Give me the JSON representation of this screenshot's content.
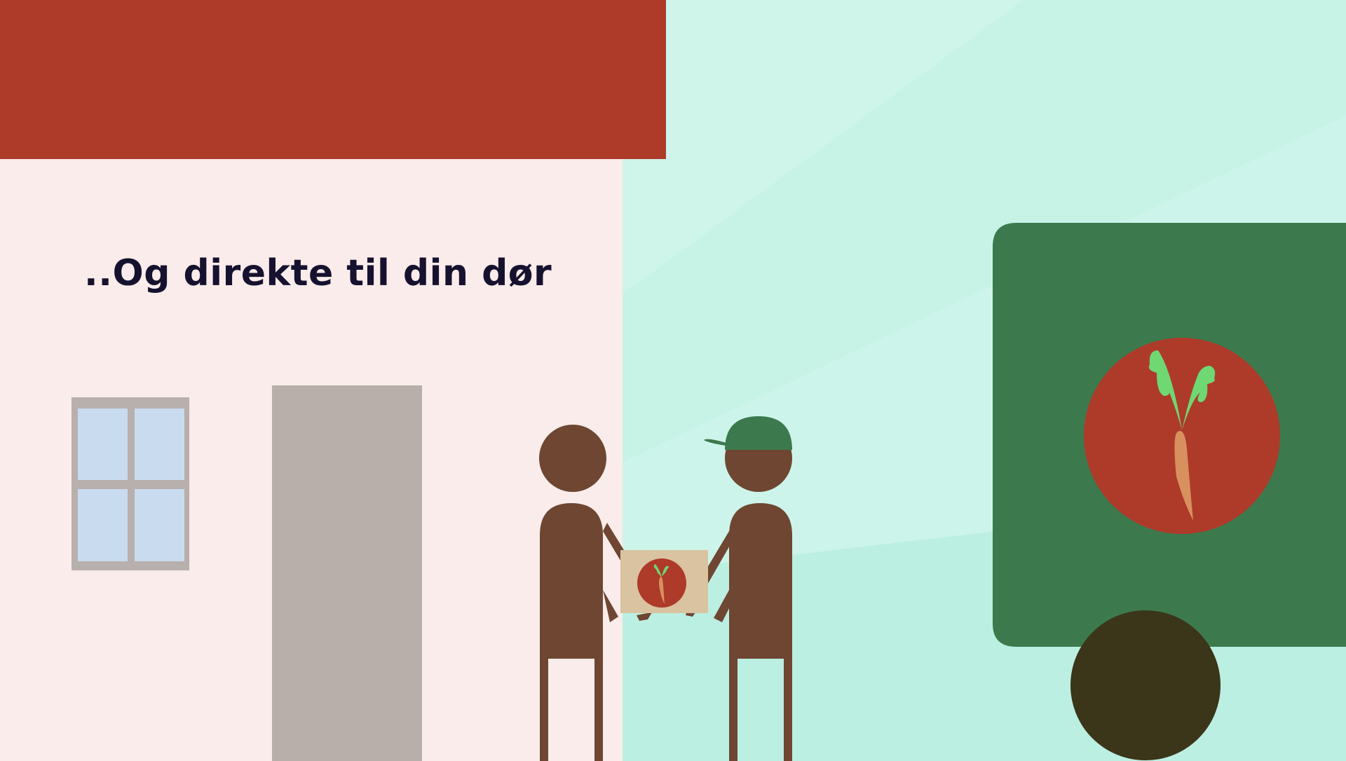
{
  "headline": "..Og direkte til din dør",
  "colors": {
    "roof": "#ae3a2a",
    "house_wall": "#f9ecea",
    "sky_light": "#cff5eb",
    "sky_mid": "#c4f2e6",
    "sky_low": "#bbefe2",
    "window_frame": "#b8b0ad",
    "window_glass": "#c9dbef",
    "door": "#b8afab",
    "person_skin": "#6e4632",
    "cap": "#3c7a4d",
    "parcel": "#d9c3a0",
    "badge_red": "#ae3a2a",
    "carrot": "#d8915e",
    "leaves": "#6fd873",
    "truck": "#3c7a4d",
    "wheel": "#3b3519"
  },
  "icons": {
    "parcel_logo": "carrot-logo-icon",
    "truck_logo": "carrot-logo-icon"
  }
}
